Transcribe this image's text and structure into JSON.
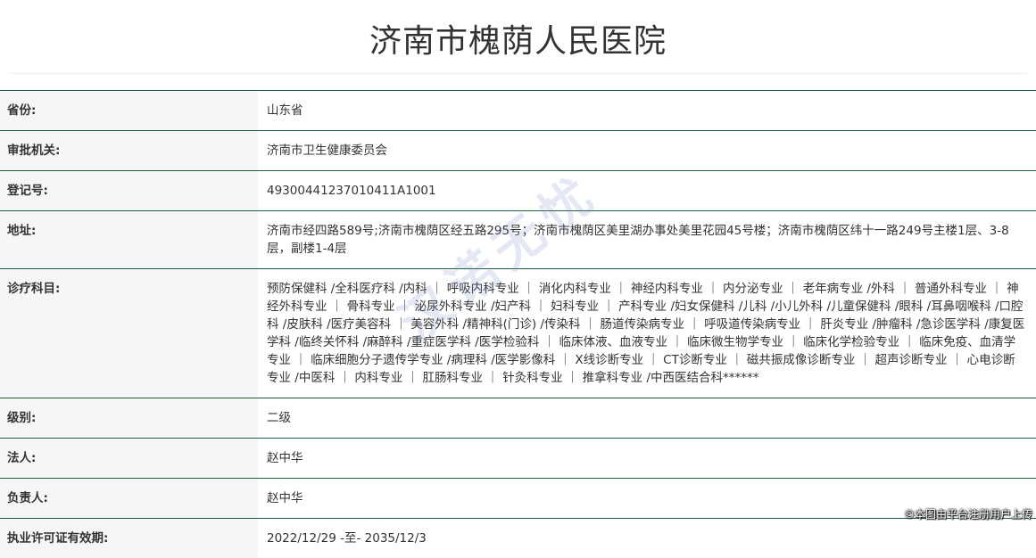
{
  "page": {
    "title": "济南市槐荫人民医院"
  },
  "rows": [
    {
      "label": "省份:",
      "value": "山东省"
    },
    {
      "label": "审批机关:",
      "value": "济南市卫生健康委员会"
    },
    {
      "label": "登记号:",
      "value": "49300441237010411A1001"
    },
    {
      "label": "地址:",
      "value": "济南市经四路589号;济南市槐荫区经五路295号；济南市槐荫区美里湖办事处美里花园45号楼；济南市槐荫区纬十一路249号主楼1层、3-8层，副楼1-4层"
    },
    {
      "label": "诊疗科目:",
      "value": "预防保健科 /全科医疗科 /内科 ｜ 呼吸内科专业 ｜ 消化内科专业 ｜ 神经内科专业 ｜ 内分泌专业 ｜ 老年病专业 /外科 ｜ 普通外科专业 ｜ 神经外科专业 ｜ 骨科专业 ｜ 泌尿外科专业 /妇产科 ｜ 妇科专业 ｜ 产科专业 /妇女保健科 /儿科 /小儿外科 /儿童保健科 /眼科 /耳鼻咽喉科 /口腔科 /皮肤科 /医疗美容科 ｜ 美容外科 /精神科(门诊) /传染科 ｜ 肠道传染病专业 ｜ 呼吸道传染病专业 ｜ 肝炎专业 /肿瘤科 /急诊医学科 /康复医学科 /临终关怀科 /麻醉科 /重症医学科 /医学检验科 ｜ 临床体液、血液专业 ｜ 临床微生物学专业 ｜ 临床化学检验专业 ｜ 临床免疫、血清学专业 ｜ 临床细胞分子遗传学专业 /病理科 /医学影像科 ｜ X线诊断专业 ｜ CT诊断专业 ｜ 磁共振成像诊断专业 ｜ 超声诊断专业 ｜ 心电诊断专业 /中医科 ｜ 内科专业 ｜ 肛肠科专业 ｜ 针灸科专业 ｜ 推拿科专业 /中西医结合科******"
    },
    {
      "label": "级别:",
      "value": "二级"
    },
    {
      "label": "法人:",
      "value": "赵中华"
    },
    {
      "label": "负责人:",
      "value": "赵中华"
    },
    {
      "label": "执业许可证有效期:",
      "value": "2022/12/29 -至- 2035/12/3"
    }
  ],
  "watermark": "汉诺无忧",
  "copyright": "©本图由平台注册用户上传"
}
